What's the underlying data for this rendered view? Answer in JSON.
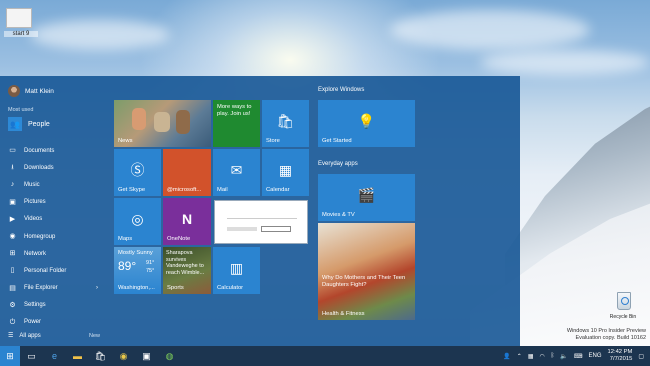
{
  "desktop": {
    "thumbnail_label": "start 9",
    "recycle_bin_label": "Recycle Bin",
    "watermark": {
      "line1": "Windows 10 Pro Insider Preview",
      "line2": "Evaluation copy. Build 10162"
    }
  },
  "start_menu": {
    "user_name": "Matt Klein",
    "most_used_label": "Most used",
    "most_used": [
      {
        "label": "People",
        "icon": "people-icon"
      }
    ],
    "places": [
      {
        "label": "Documents",
        "icon": "documents-icon"
      },
      {
        "label": "Downloads",
        "icon": "downloads-icon"
      },
      {
        "label": "Music",
        "icon": "music-icon"
      },
      {
        "label": "Pictures",
        "icon": "pictures-icon"
      },
      {
        "label": "Videos",
        "icon": "videos-icon"
      },
      {
        "label": "Homegroup",
        "icon": "homegroup-icon"
      },
      {
        "label": "Network",
        "icon": "network-icon"
      },
      {
        "label": "Personal Folder",
        "icon": "personal-folder-icon"
      },
      {
        "label": "File Explorer",
        "icon": "file-explorer-icon"
      },
      {
        "label": "Settings",
        "icon": "settings-icon"
      },
      {
        "label": "Power",
        "icon": "power-icon"
      }
    ],
    "all_apps_label": "All apps",
    "new_label": "New",
    "tiles": {
      "news": "News",
      "store_promo": "More ways to play. Join us!",
      "store": "Store",
      "get_skype": "Get Skype",
      "twitter": "@microsoft...",
      "mail": "Mail",
      "calendar": "Calendar",
      "maps": "Maps",
      "onenote": "OneNote",
      "weather_condition": "Mostly Sunny",
      "weather_temp": "89°",
      "weather_high": "91°",
      "weather_low": "75°",
      "weather_city": "Washington,...",
      "sports_headline": "Sharapova survives Vandeweghe to reach Wimble...",
      "sports": "Sports",
      "calculator": "Calculator"
    },
    "explore_title": "Explore Windows",
    "get_started": "Get Started",
    "everyday_title": "Everyday apps",
    "movies_tv": "Movies & TV",
    "health_headline": "Why Do Mothers and Their Teen Daughters Fight?",
    "health_fitness": "Health & Fitness"
  },
  "taskbar": {
    "language": "ENG",
    "time": "12:42 PM",
    "date": "7/7/2015"
  },
  "colors": {
    "accent": "#2b84d0",
    "start_bg": "#165696",
    "taskbar_bg": "#1c3550",
    "onenote": "#7a2f9b",
    "twitter": "#d2522b",
    "store_promo": "#1f8a30"
  }
}
